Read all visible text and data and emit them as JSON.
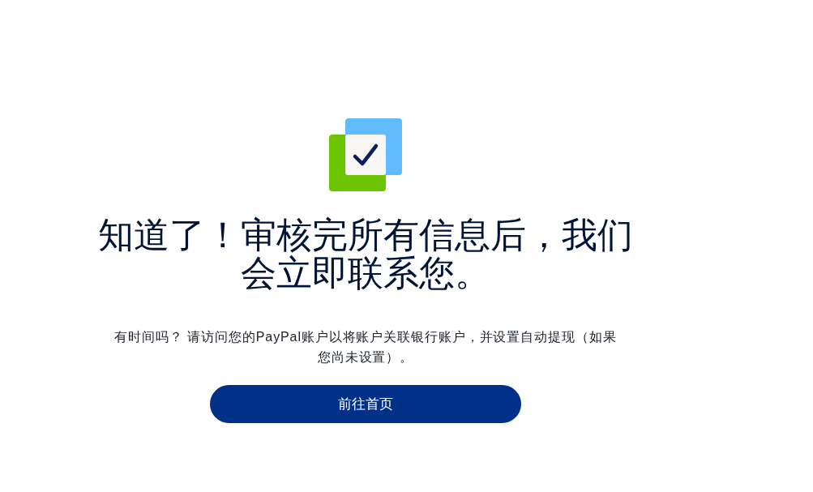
{
  "heading": "知道了！审核完所有信息后，我们会立即联系您。",
  "message": "有时间吗？ 请访问您的PayPal账户以将账户关联银行账户，并设置自动提现（如果您尚未设置）。",
  "button": {
    "label": "前往首页"
  }
}
